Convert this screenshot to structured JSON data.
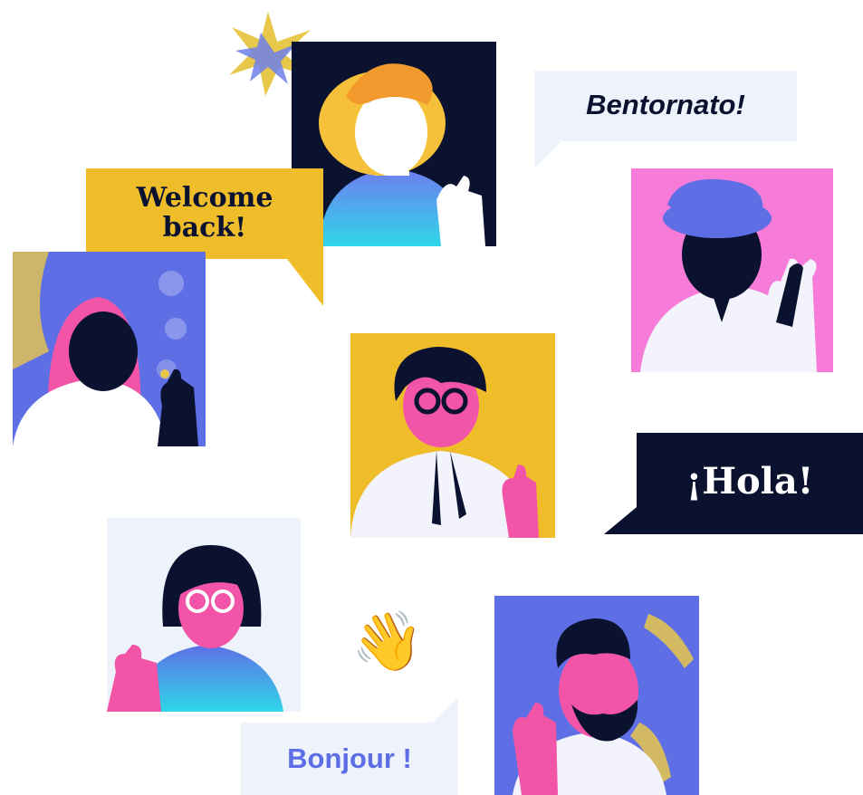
{
  "greetings": {
    "welcome_back": "Welcome\nback!",
    "bentornato": "Bentornato!",
    "hola": "¡Hola!",
    "bonjour": "Bonjour !"
  },
  "emoji": {
    "waving_hand": "👋"
  },
  "colors": {
    "navy": "#0b1230",
    "mustard": "#f0bd2a",
    "pink": "#f254a8",
    "magenta_bg": "#f77bd9",
    "periwinkle": "#5e6fe6",
    "light_panel": "#eef2fb",
    "teal": "#34d1e8"
  },
  "icons": [
    "sparkle-icon",
    "waving-hand-icon"
  ]
}
